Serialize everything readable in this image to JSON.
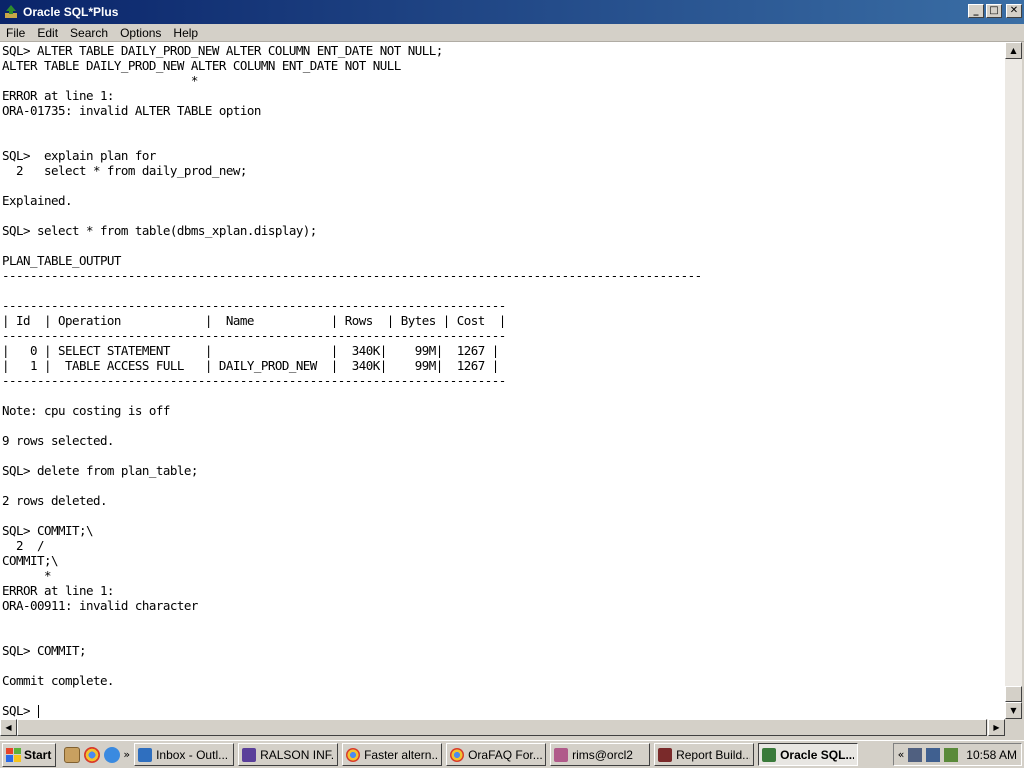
{
  "window": {
    "title": "Oracle SQL*Plus",
    "buttons": {
      "minimize": "_",
      "maximize": "□",
      "close": "✕"
    }
  },
  "menu": {
    "items": [
      "File",
      "Edit",
      "Search",
      "Options",
      "Help"
    ]
  },
  "console": {
    "lines": [
      "SQL> ALTER TABLE DAILY_PROD_NEW ALTER COLUMN ENT_DATE NOT NULL;",
      "ALTER TABLE DAILY_PROD_NEW ALTER COLUMN ENT_DATE NOT NULL",
      "                           *",
      "ERROR at line 1:",
      "ORA-01735: invalid ALTER TABLE option",
      "",
      "",
      "SQL>  explain plan for",
      "  2   select * from daily_prod_new;",
      "",
      "Explained.",
      "",
      "SQL> select * from table(dbms_xplan.display);",
      "",
      "PLAN_TABLE_OUTPUT",
      "----------------------------------------------------------------------------------------------------",
      "",
      "------------------------------------------------------------------------",
      "| Id  | Operation            |  Name           | Rows  | Bytes | Cost  |",
      "------------------------------------------------------------------------",
      "|   0 | SELECT STATEMENT     |                 |  340K|    99M|  1267 |",
      "|   1 |  TABLE ACCESS FULL   | DAILY_PROD_NEW  |  340K|    99M|  1267 |",
      "------------------------------------------------------------------------",
      "",
      "Note: cpu costing is off",
      "",
      "9 rows selected.",
      "",
      "SQL> delete from plan_table;",
      "",
      "2 rows deleted.",
      "",
      "SQL> COMMIT;\\",
      "  2  /",
      "COMMIT;\\",
      "      *",
      "ERROR at line 1:",
      "ORA-00911: invalid character",
      "",
      "",
      "SQL> COMMIT;",
      "",
      "Commit complete.",
      ""
    ],
    "prompt": "SQL> "
  },
  "taskbar": {
    "start_label": "Start",
    "chevron": "»",
    "tasks": [
      {
        "label": "Inbox - Outl...",
        "icon": "outlook-icon",
        "color": "#2f6fbf"
      },
      {
        "label": "RALSON INF...",
        "icon": "document-icon",
        "color": "#5a3f9a"
      },
      {
        "label": "Faster altern...",
        "icon": "chrome-icon",
        "color": "#d93a2b"
      },
      {
        "label": "OraFAQ For...",
        "icon": "chrome-icon",
        "color": "#d93a2b"
      },
      {
        "label": "rims@orcl2",
        "icon": "database-icon",
        "color": "#b05a8a"
      },
      {
        "label": "Report Build...",
        "icon": "report-icon",
        "color": "#7a2a2a"
      },
      {
        "label": "Oracle SQL...",
        "icon": "sqlplus-icon",
        "color": "#3a7a3a",
        "active": true
      }
    ],
    "tray_chevron": "«",
    "clock": "10:58 AM"
  }
}
